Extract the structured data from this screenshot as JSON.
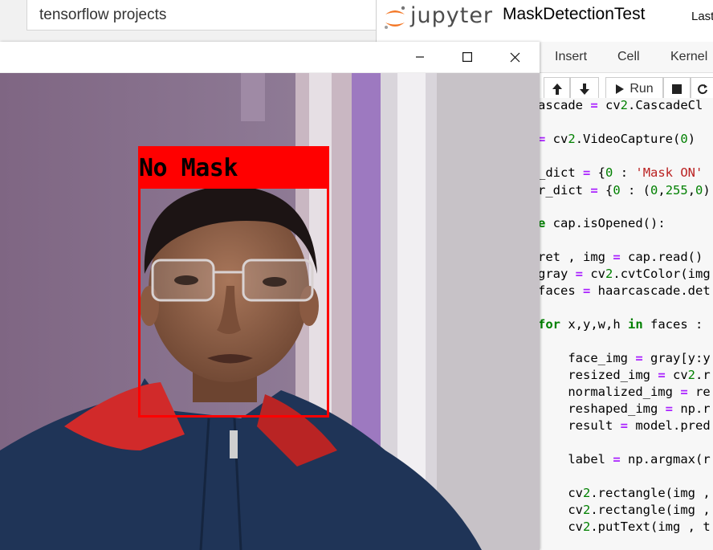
{
  "browser": {
    "search_text": "tensorflow projects"
  },
  "jupyter": {
    "brand": "jupyter",
    "notebook_title": "MaskDetectionTest",
    "last_checkpoint": "Last Ch",
    "menu": [
      "Insert",
      "Cell",
      "Kernel"
    ],
    "toolbar": {
      "run_label": "Run"
    },
    "code_lines": [
      "ascade = cv2.CascadeCl",
      "= cv2.VideoCapture(0)",
      "_dict = {0 : 'Mask ON'",
      "r_dict = {0 : (0,255,0)",
      "e cap.isOpened():",
      "ret , img = cap.read()",
      "gray = cv2.cvtColor(img",
      "faces = haarcascade.det",
      "for x,y,w,h in faces :",
      "    face_img = gray[y:y",
      "    resized_img = cv2.r",
      "    normalized_img = re",
      "    reshaped_img = np.r",
      "    result = model.pred",
      "    label = np.argmax(r",
      "    cv2.rectangle(img ,",
      "    cv2.rectangle(img ,",
      "    cv2.putText(img , t"
    ]
  },
  "webcam": {
    "detection_label": "No Mask",
    "box_color": "#ff0000"
  },
  "icons": {
    "minimize": "minimize-icon",
    "maximize": "maximize-icon",
    "close": "close-icon",
    "move_up": "arrow-up-icon",
    "move_down": "arrow-down-icon",
    "run": "play-icon",
    "stop": "stop-icon",
    "restart": "restart-icon"
  }
}
